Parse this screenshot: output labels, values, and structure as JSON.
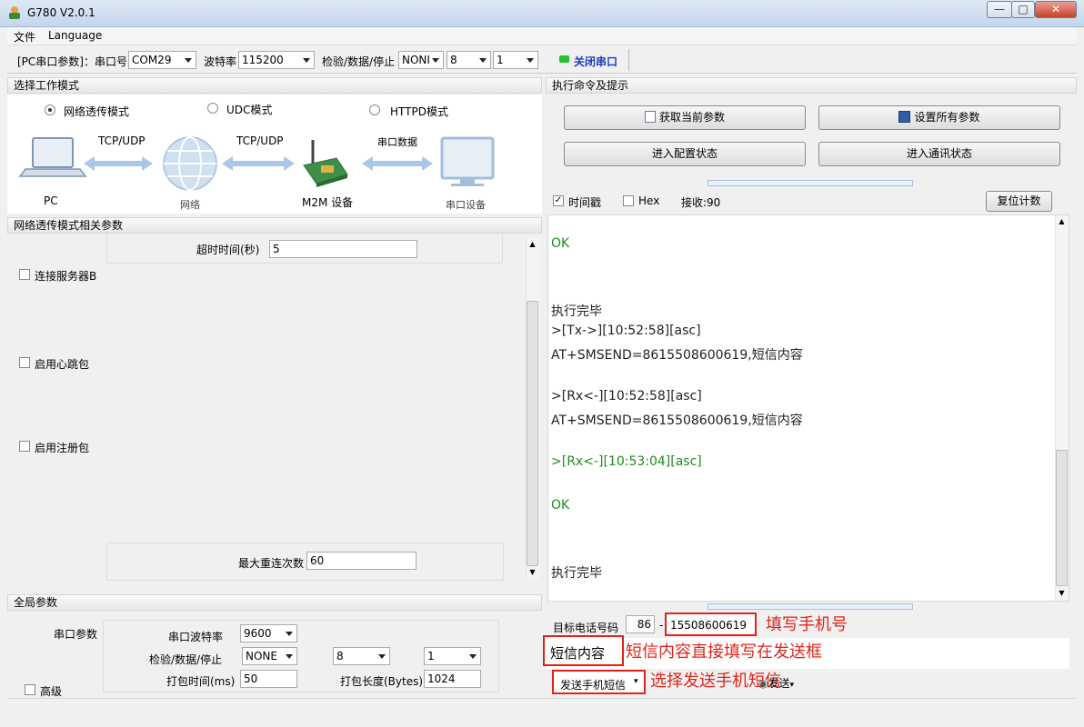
{
  "window": {
    "title": "G780 V2.0.1",
    "min": "▭",
    "max": "□",
    "close": "✕"
  },
  "menu": [
    "文件",
    "Language"
  ],
  "toolbar": {
    "serial_label": "[PC串口参数]：串口号",
    "port": "COM29",
    "baud_label": "波特率",
    "baud": "115200",
    "parity_label": "检验/数据/停止",
    "parity": "NONI",
    "databits": "8",
    "stopbits": "1",
    "close_port": "关闭串口",
    "status_color": "#22c22a"
  },
  "left": {
    "mode_header": "选择工作模式",
    "modes": [
      {
        "label": "网络透传模式",
        "selected": true
      },
      {
        "label": "UDC模式",
        "selected": false
      },
      {
        "label": "HTTPD模式",
        "selected": false
      }
    ],
    "diagram": {
      "pc": "PC",
      "tcp1": "TCP/UDP",
      "net": "网络",
      "tcp2": "TCP/UDP",
      "m2m": "M2M 设备",
      "serial_data": "串口数据",
      "serial_dev": "串口设备"
    },
    "params_header": "网络透传模式相关参数",
    "timeout_label": "超时时间(秒)",
    "timeout": "5",
    "connect_b": "连接服务器B",
    "heartbeat": "启用心跳包",
    "register": "启用注册包",
    "reconnect_label": "最大重连次数",
    "reconnect": "60",
    "global_header": "全局参数",
    "serial_params": "串口参数",
    "baud_label": "串口波特率",
    "baud": "9600",
    "parity_label": "检验/数据/停止",
    "parity": "NONE",
    "databits": "8",
    "stopbits": "1",
    "pack_time_label": "打包时间(ms)",
    "pack_time": "50",
    "pack_len_label": "打包长度(Bytes)",
    "pack_len": "1024",
    "advanced": "高级"
  },
  "right": {
    "header": "执行命令及提示",
    "btn_get": "获取当前参数",
    "btn_set": "设置所有参数",
    "btn_config": "进入配置状态",
    "btn_comm": "进入通讯状态",
    "timestamp": "时间戳",
    "hex": "Hex",
    "rx_count": "接收:90",
    "reset": "复位计数",
    "log": [
      {
        "t": "OK",
        "c": "#1e8c1e"
      },
      {
        "t": "执行完毕",
        "c": "#222"
      },
      {
        "t": ">[Tx->][10:52:58][asc]",
        "c": "#222"
      },
      {
        "t": "AT+SMSEND=8615508600619,短信内容",
        "c": "#222"
      },
      {
        "t": ">[Rx<-][10:52:58][asc]",
        "c": "#222"
      },
      {
        "t": "AT+SMSEND=8615508600619,短信内容",
        "c": "#222"
      },
      {
        "t": ">[Rx<-][10:53:04][asc]",
        "c": "#1e8c1e"
      },
      {
        "t": "OK",
        "c": "#1e8c1e"
      },
      {
        "t": "执行完毕",
        "c": "#222"
      }
    ],
    "phone_label": "目标电话号码",
    "country": "86",
    "dash": "-",
    "phone": "15508600619",
    "sms_content": "短信内容",
    "send_mode": "发送手机短信",
    "send": "发送",
    "note_phone": "填写手机号",
    "note_content": "短信内容直接填写在发送框",
    "note_send": "选择发送手机短信"
  }
}
